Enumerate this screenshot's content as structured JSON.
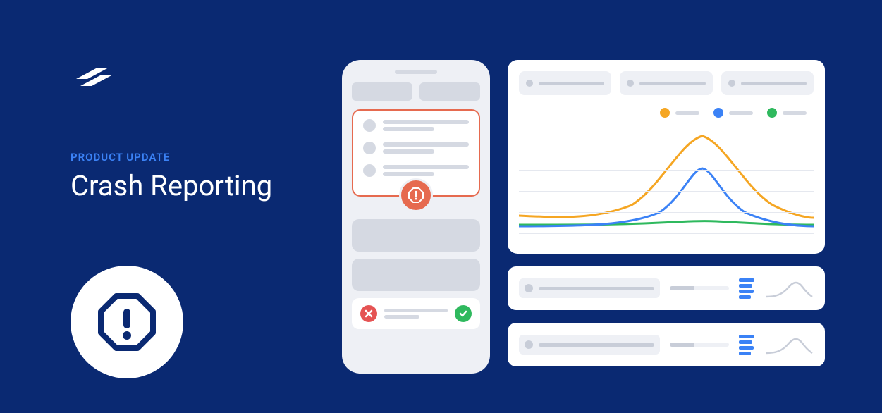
{
  "eyebrow": "PRODUCT UPDATE",
  "title": "Crash Reporting",
  "colors": {
    "background": "#0a2972",
    "accent_blue": "#3b82f6",
    "orange": "#f5a623",
    "green": "#2fb95e",
    "red": "#e55353",
    "alert": "#e66a4f"
  },
  "chart_data": {
    "type": "line",
    "title": "",
    "xlabel": "",
    "ylabel": "",
    "x": [
      0,
      1,
      2,
      3,
      4,
      5,
      6,
      7,
      8,
      9,
      10
    ],
    "series": [
      {
        "name": "orange",
        "color": "#f5a623",
        "values": [
          20,
          18,
          15,
          18,
          35,
          70,
          95,
          70,
          35,
          18,
          15
        ]
      },
      {
        "name": "blue",
        "color": "#3b82f6",
        "values": [
          10,
          10,
          10,
          12,
          20,
          42,
          60,
          42,
          20,
          12,
          10
        ]
      },
      {
        "name": "green",
        "color": "#2fb95e",
        "values": [
          8,
          8,
          8,
          8,
          9,
          10,
          11,
          10,
          9,
          8,
          8
        ]
      }
    ],
    "ylim": [
      0,
      100
    ],
    "legend_position": "top-right",
    "grid": true
  }
}
